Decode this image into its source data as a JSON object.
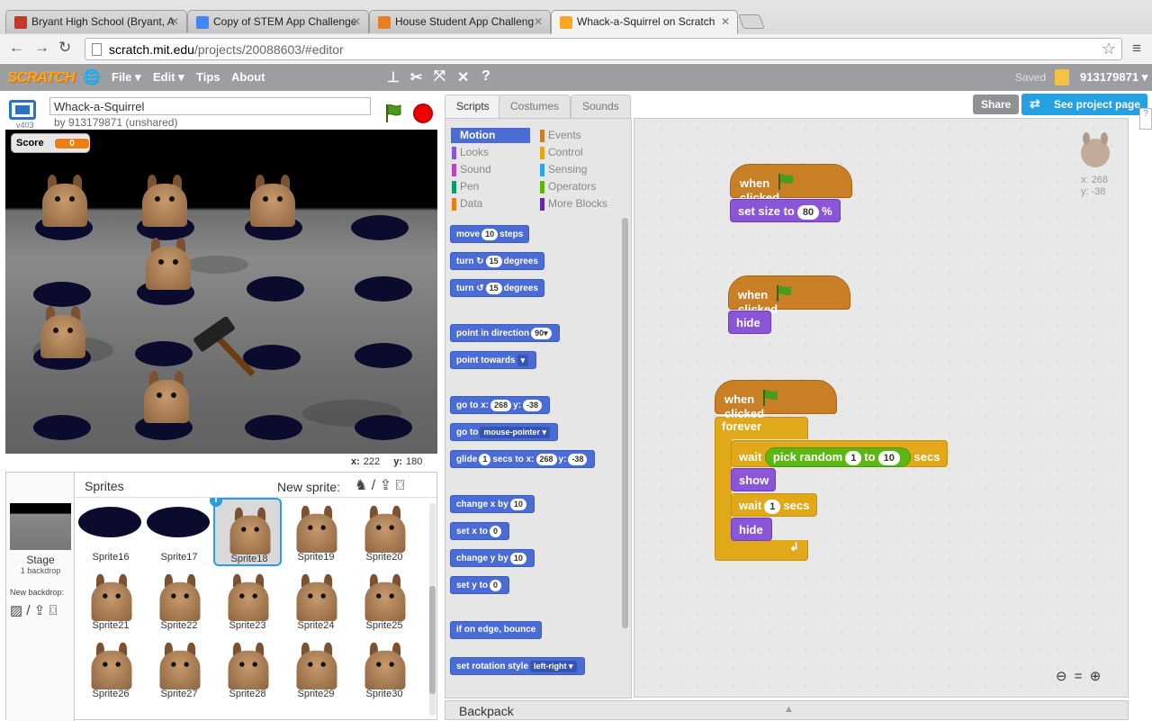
{
  "browser": {
    "tabs": [
      {
        "label": "Bryant High School (Bryant, A",
        "color": "#c0392b"
      },
      {
        "label": "Copy of STEM App Challenge",
        "color": "#4285f4"
      },
      {
        "label": "House Student App Challeng",
        "color": "#e67e22"
      },
      {
        "label": "Whack-a-Squirrel on Scratch",
        "color": "#f9a626"
      }
    ],
    "url_host": "scratch.mit.edu",
    "url_path": "/projects/20088603/#editor"
  },
  "scratch_bar": {
    "logo": "SCRATCH",
    "file": "File",
    "edit": "Edit",
    "tips": "Tips",
    "about": "About",
    "saved": "Saved",
    "username": "913179871"
  },
  "project": {
    "title": "Whack-a-Squirrel",
    "byline": "by 913179871 (unshared)",
    "version": "v403",
    "score_label": "Score",
    "score_value": "0",
    "mouse_x_label": "x:",
    "mouse_x": "222",
    "mouse_y_label": "y:",
    "mouse_y": "180"
  },
  "sprites_pane": {
    "title": "Sprites",
    "new_sprite": "New sprite:",
    "stage_label": "Stage",
    "stage_sub": "1 backdrop",
    "new_backdrop": "New backdrop:",
    "sprites": [
      {
        "name": "Sprite16",
        "kind": "hole"
      },
      {
        "name": "Sprite17",
        "kind": "hole"
      },
      {
        "name": "Sprite18",
        "kind": "squirrel",
        "selected": true
      },
      {
        "name": "Sprite19",
        "kind": "squirrel"
      },
      {
        "name": "Sprite20",
        "kind": "squirrel"
      },
      {
        "name": "Sprite21",
        "kind": "squirrel"
      },
      {
        "name": "Sprite22",
        "kind": "squirrel"
      },
      {
        "name": "Sprite23",
        "kind": "squirrel"
      },
      {
        "name": "Sprite24",
        "kind": "squirrel"
      },
      {
        "name": "Sprite25",
        "kind": "squirrel"
      },
      {
        "name": "Sprite26",
        "kind": "squirrel"
      },
      {
        "name": "Sprite27",
        "kind": "squirrel"
      },
      {
        "name": "Sprite28",
        "kind": "squirrel"
      },
      {
        "name": "Sprite29",
        "kind": "squirrel"
      },
      {
        "name": "Sprite30",
        "kind": "squirrel"
      }
    ]
  },
  "editor_tabs": {
    "scripts": "Scripts",
    "costumes": "Costumes",
    "sounds": "Sounds"
  },
  "categories": [
    {
      "label": "Motion",
      "color": "#4a6cd4"
    },
    {
      "label": "Events",
      "color": "#c97f26"
    },
    {
      "label": "Looks",
      "color": "#8a55d7"
    },
    {
      "label": "Control",
      "color": "#e1a91a"
    },
    {
      "label": "Sound",
      "color": "#bb42c3"
    },
    {
      "label": "Sensing",
      "color": "#2ca5e2"
    },
    {
      "label": "Pen",
      "color": "#0e9a6c"
    },
    {
      "label": "Operators",
      "color": "#5cb712"
    },
    {
      "label": "Data",
      "color": "#ee7d16"
    },
    {
      "label": "More Blocks",
      "color": "#632d99"
    }
  ],
  "palette": {
    "move": [
      "move",
      "10",
      "steps"
    ],
    "turn_cw": [
      "turn",
      "15",
      "degrees"
    ],
    "turn_ccw": [
      "turn",
      "15",
      "degrees"
    ],
    "point_dir": [
      "point in direction",
      "90▾"
    ],
    "point_towards": [
      "point towards",
      "▾"
    ],
    "goto_xy": [
      "go to x:",
      "268",
      "y:",
      "-38"
    ],
    "goto": [
      "go to",
      "mouse-pointer ▾"
    ],
    "glide": [
      "glide",
      "1",
      "secs to x:",
      "268",
      "y:",
      "-38"
    ],
    "change_x": [
      "change x by",
      "10"
    ],
    "set_x": [
      "set x to",
      "0"
    ],
    "change_y": [
      "change y by",
      "10"
    ],
    "set_y": [
      "set y to",
      "0"
    ],
    "bounce": "if on edge, bounce",
    "rotation": [
      "set rotation style",
      "left-right ▾"
    ]
  },
  "scripts": {
    "script1": {
      "when": "when",
      "clicked": "clicked",
      "set_size": "set size to",
      "size_val": "80",
      "pct": "%"
    },
    "script2": {
      "when": "when",
      "clicked": "clicked",
      "hide": "hide"
    },
    "script3": {
      "when": "when",
      "clicked": "clicked",
      "forever": "forever",
      "wait": "wait",
      "pick_random": "pick random",
      "from": "1",
      "to": "to",
      "to_val": "10",
      "secs": "secs",
      "show": "show",
      "wait2": "wait",
      "wait2_val": "1",
      "secs2": "secs",
      "hide": "hide"
    },
    "sprite_x": "x: 268",
    "sprite_y": "y: -38"
  },
  "buttons": {
    "share": "Share",
    "see_project": "See project page"
  },
  "backpack": "Backpack"
}
